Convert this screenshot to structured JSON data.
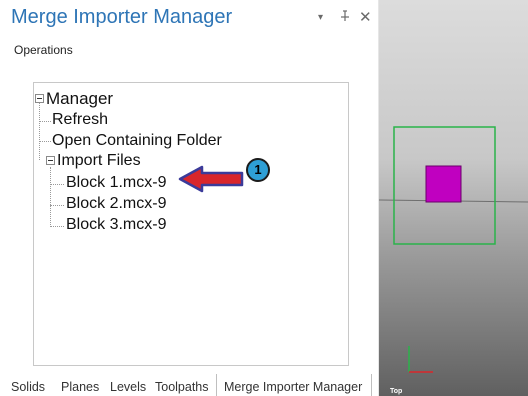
{
  "panel": {
    "title": "Merge Importer Manager",
    "controls": {
      "dropdown": "▾",
      "pin": "⊥",
      "close": "✕"
    },
    "operations_label": "Operations"
  },
  "tree": {
    "root": "Manager",
    "children": [
      "Refresh",
      "Open Containing Folder"
    ],
    "import_files": {
      "label": "Import Files",
      "files": [
        "Block 1.mcx-9",
        "Block 2.mcx-9",
        "Block 3.mcx-9"
      ]
    }
  },
  "callout": {
    "number": "1",
    "color": "#2e9fd6",
    "arrow_color": "#d9262b"
  },
  "tabs": [
    "Solids",
    "Planes",
    "Levels",
    "Toolpaths",
    "Merge Importer Manager"
  ],
  "viewport": {
    "view_label": "Top",
    "box_color": "#2ab34a",
    "part_color": "#c000c0"
  }
}
